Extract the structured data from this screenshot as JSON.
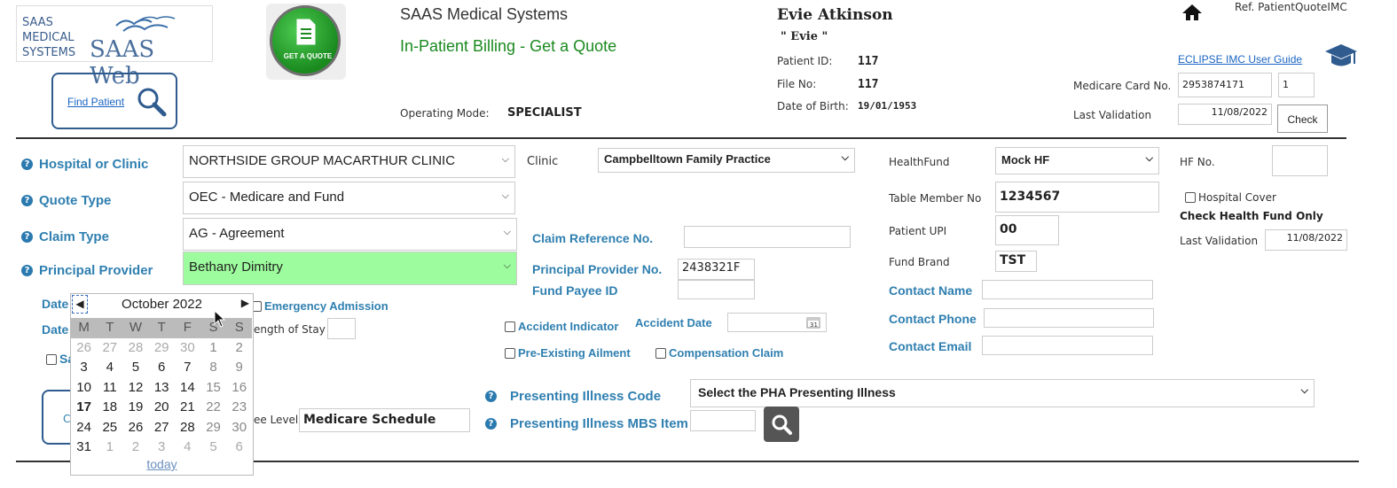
{
  "logo": {
    "line1": "SAAS",
    "line2": "MEDICAL",
    "line3": "SYSTEMS",
    "web": "SAAS Web"
  },
  "find_patient": {
    "label": "Find Patient"
  },
  "get_quote": {
    "label": "GET A QUOTE"
  },
  "header": {
    "title": "SAAS Medical Systems",
    "subtitle": "In-Patient Billing - Get a Quote",
    "operating_mode_label": "Operating Mode:",
    "operating_mode": "SPECIALIST"
  },
  "patient": {
    "name": "Evie Atkinson",
    "nickname": "\" Evie \"",
    "id_label": "Patient ID:",
    "id": "117",
    "file_label": "File No:",
    "file": "117",
    "dob_label": "Date of Birth:",
    "dob": "19/01/1953"
  },
  "ref": "Ref. PatientQuoteIMC",
  "guide_link": "ECLIPSE IMC User Guide",
  "medicare": {
    "card_label": "Medicare Card No.",
    "card": "2953874171",
    "irn": "1",
    "validation_label": "Last Validation",
    "validation": "11/08/2022",
    "check": "Check"
  },
  "form": {
    "hospital_label": "Hospital or Clinic",
    "hospital": "NORTHSIDE GROUP MACARTHUR CLINIC",
    "quote_type_label": "Quote Type",
    "quote_type": "OEC - Medicare and Fund",
    "claim_type_label": "Claim Type",
    "claim_type": "AG - Agreement",
    "provider_label": "Principal Provider",
    "provider": "Bethany Dimitry",
    "clinic_label": "Clinic",
    "clinic": "Campbelltown Family Practice",
    "claim_ref_label": "Claim Reference No.",
    "claim_ref": "",
    "provider_no_label": "Principal Provider No.",
    "provider_no": "2438321F",
    "fund_payee_label": "Fund Payee ID",
    "fund_payee": "",
    "date_label_1": "Date",
    "date_label_2": "Date",
    "emergency_label": "Emergency Admission",
    "length_stay_label": "ength of Stay",
    "accident_indicator_label": "Accident Indicator",
    "accident_date_label": "Accident Date",
    "pre_existing_label": "Pre-Existing Ailment",
    "compensation_label": "Compensation Claim",
    "fee_level_label": "ee Level",
    "fee_level": "Medicare Schedule",
    "presenting_code_label": "Presenting Illness Code",
    "presenting_code": "Select the PHA Presenting Illness",
    "presenting_mbs_label": "Presenting Illness MBS Item",
    "sa_partial": "Sa",
    "c_partial": "C"
  },
  "fund": {
    "healthfund_label": "HealthFund",
    "healthfund": "Mock HF",
    "hf_no_label": "HF No.",
    "member_label": "Table Member No",
    "member": "1234567",
    "upi_label": "Patient UPI",
    "upi": "00",
    "brand_label": "Fund Brand",
    "brand": "TST",
    "hospital_cover_label": "Hospital Cover",
    "check_fund_label": "Check Health Fund Only",
    "last_validation_label": "Last Validation",
    "last_validation": "11/08/2022",
    "contact_name_label": "Contact Name",
    "contact_phone_label": "Contact Phone",
    "contact_email_label": "Contact Email"
  },
  "calendar": {
    "title": "October 2022",
    "days": [
      "M",
      "T",
      "W",
      "T",
      "F",
      "S",
      "S"
    ],
    "weeks": [
      [
        "26",
        "27",
        "28",
        "29",
        "30",
        "1",
        "2"
      ],
      [
        "3",
        "4",
        "5",
        "6",
        "7",
        "8",
        "9"
      ],
      [
        "10",
        "11",
        "12",
        "13",
        "14",
        "15",
        "16"
      ],
      [
        "17",
        "18",
        "19",
        "20",
        "21",
        "22",
        "23"
      ],
      [
        "24",
        "25",
        "26",
        "27",
        "28",
        "29",
        "30"
      ],
      [
        "31",
        "1",
        "2",
        "3",
        "4",
        "5",
        "6"
      ]
    ],
    "today_label": "today",
    "today_day": "17"
  }
}
